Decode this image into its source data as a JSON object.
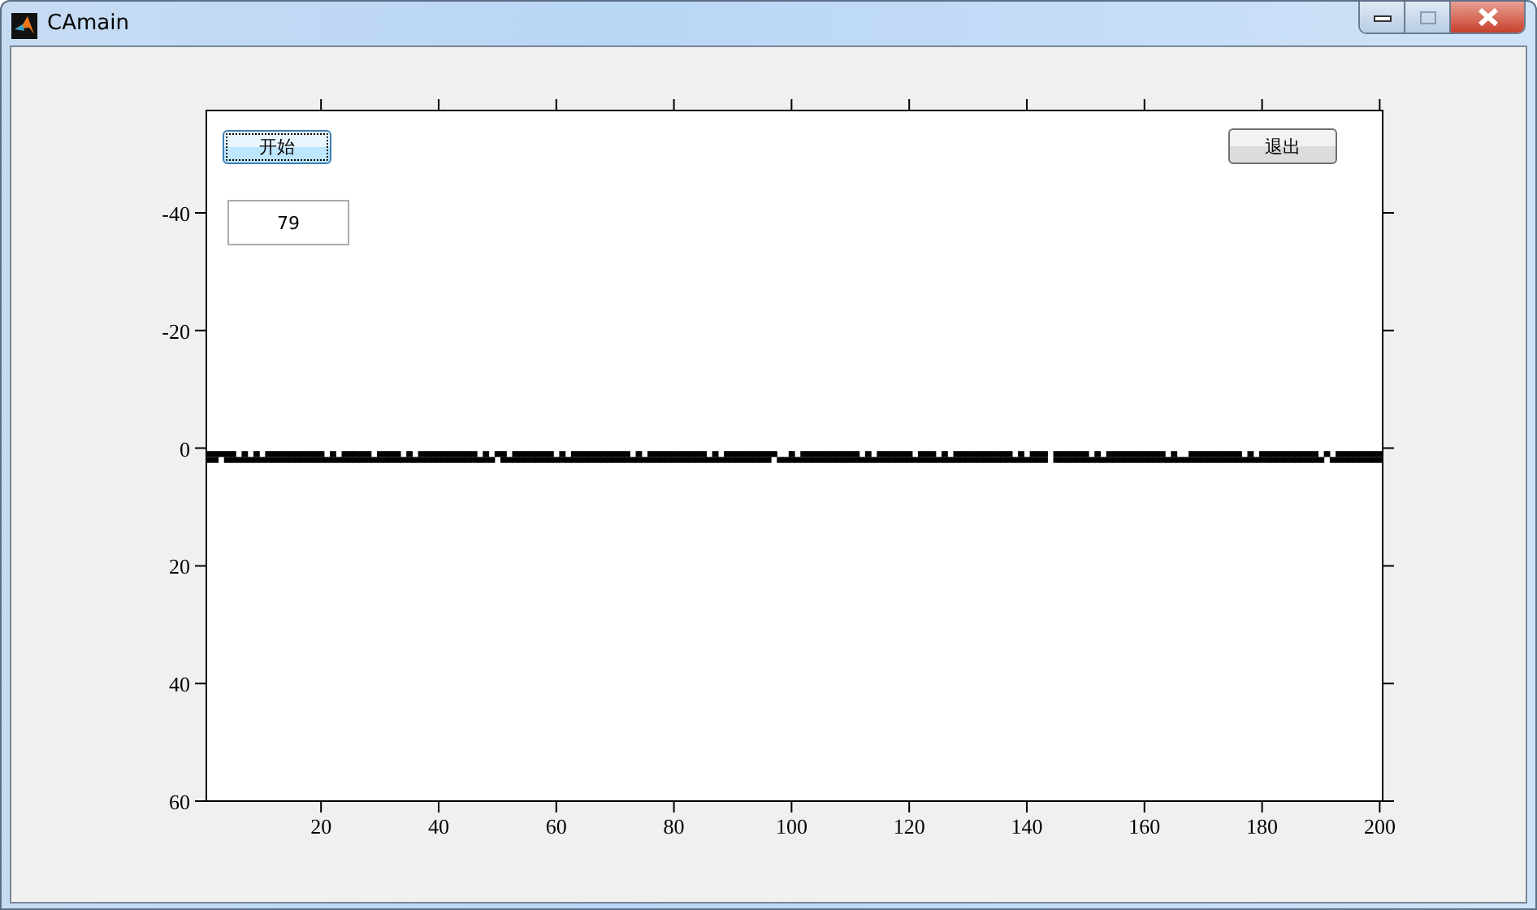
{
  "window": {
    "title": "CAmain"
  },
  "start_button": {
    "label": "开始",
    "focused": true
  },
  "exit_button": {
    "label": "退出"
  },
  "counter_field": {
    "value": "79"
  },
  "axes": {
    "xticks": [
      "20",
      "40",
      "60",
      "80",
      "100",
      "120",
      "140",
      "160",
      "180",
      "200"
    ],
    "yticks": [
      "-40",
      "-20",
      "0",
      "20",
      "40",
      "60"
    ]
  }
}
